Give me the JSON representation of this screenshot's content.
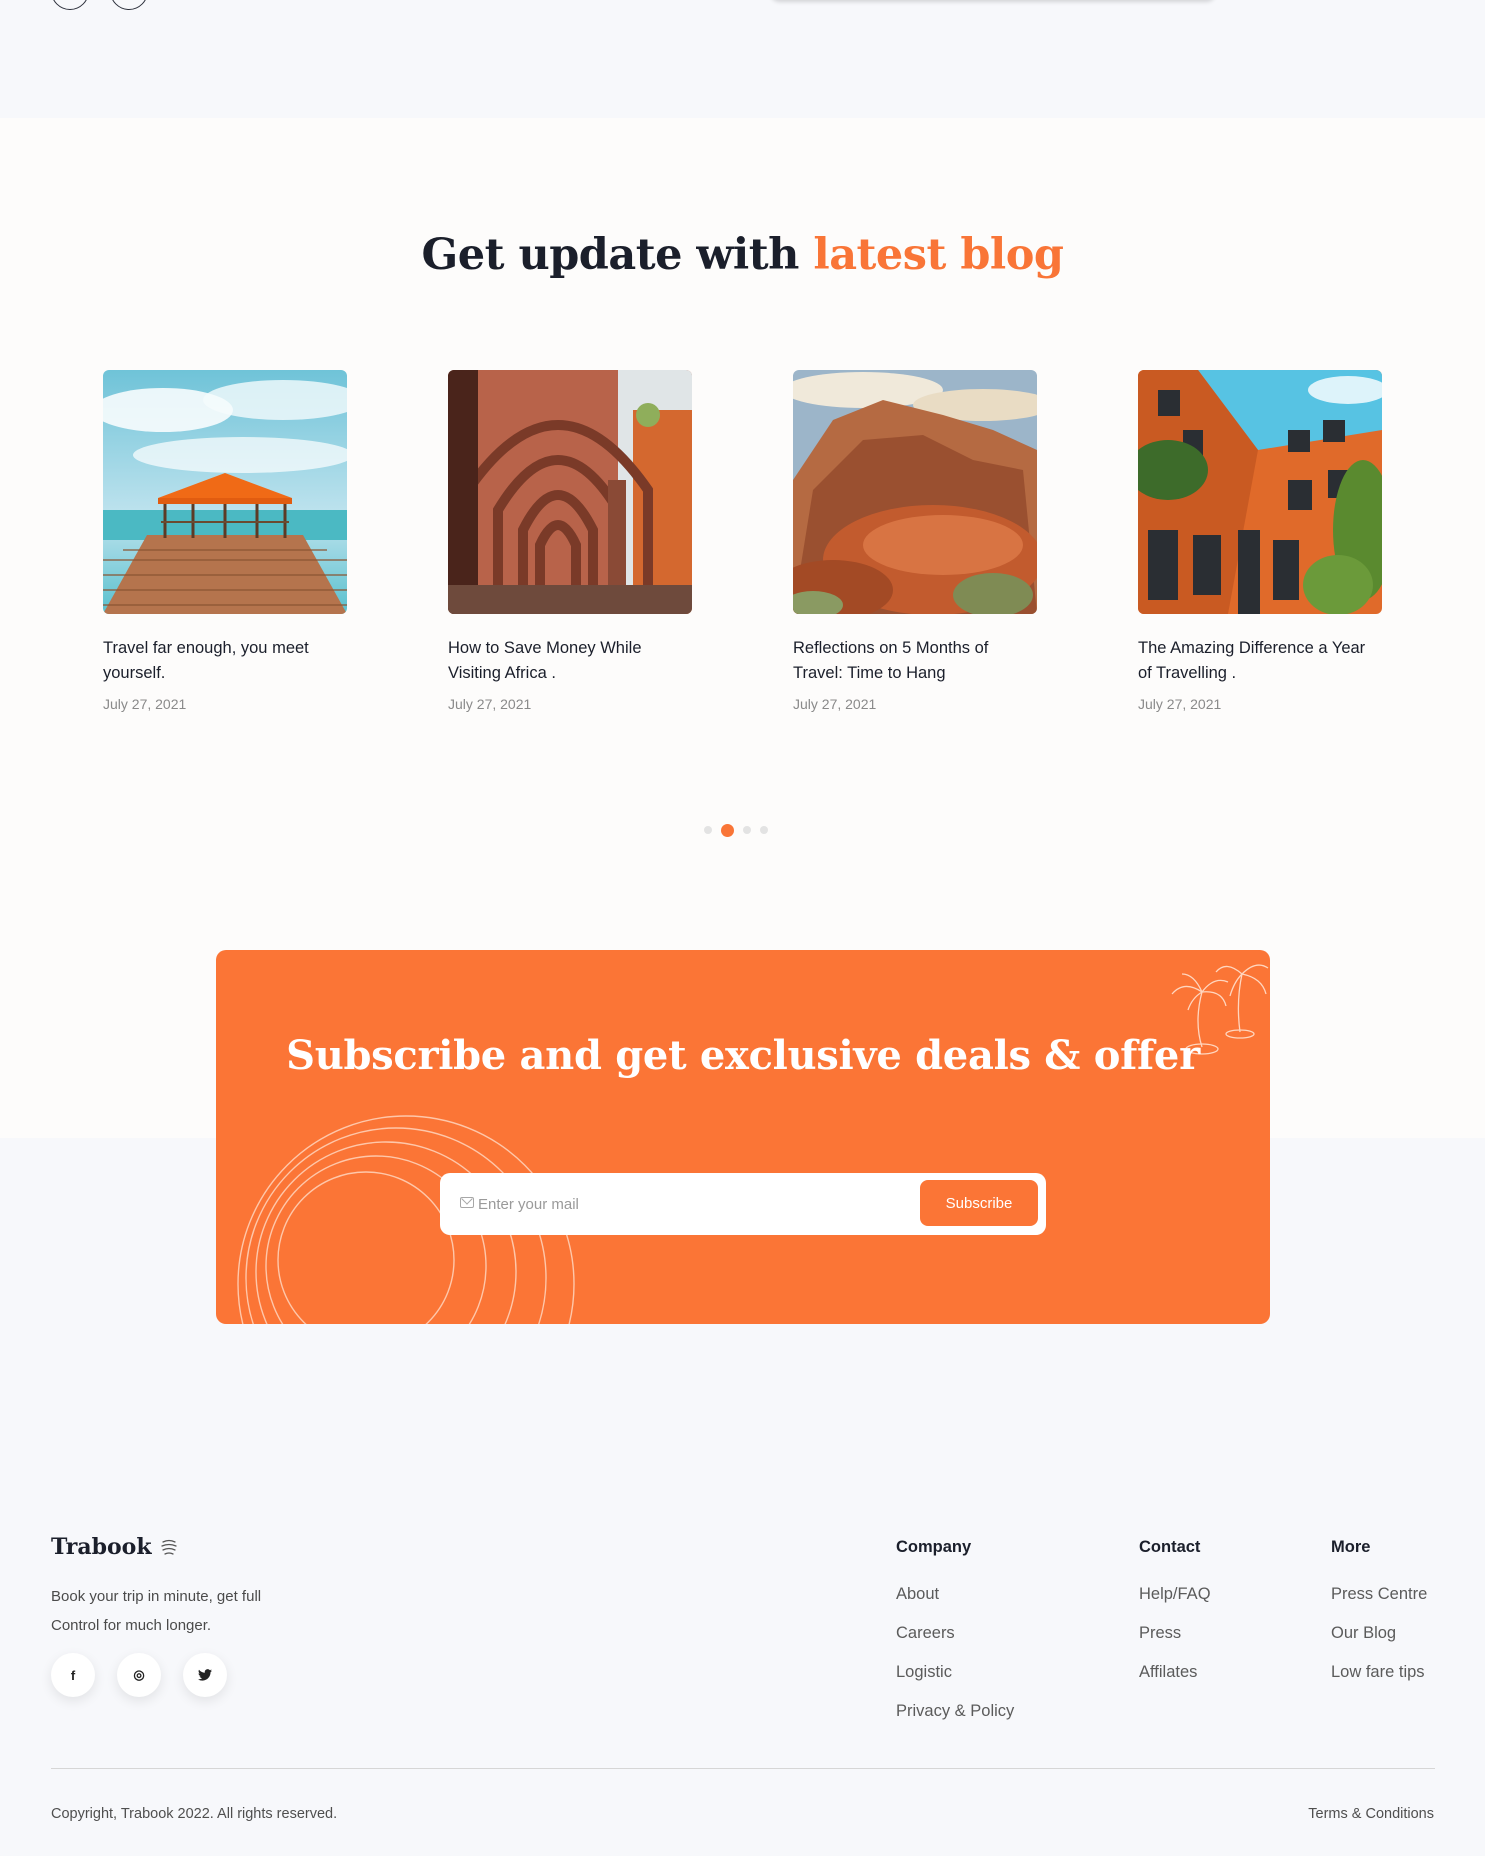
{
  "colors": {
    "accent": "#f97537",
    "dark": "#1b1f2b",
    "muted": "#8a8a8a"
  },
  "blog": {
    "title_dark": "Get update with",
    "title_accent": "latest blog",
    "posts": [
      {
        "title": "Travel far enough, you meet yourself.",
        "date": "July 27, 2021",
        "image": "wooden-pier-gazebo"
      },
      {
        "title": "How to Save Money While Visiting Africa .",
        "date": "July 27, 2021",
        "image": "arcade-corridor"
      },
      {
        "title": "Reflections on 5 Months of Travel: Time to Hang",
        "date": "July 27, 2021",
        "image": "red-rock-canyon"
      },
      {
        "title": "The Amazing Difference a Year of Travelling .",
        "date": "July 27, 2021",
        "image": "orange-building"
      }
    ],
    "carousel": {
      "pages": 4,
      "active": 2
    }
  },
  "subscribe": {
    "title": "Subscribe and get exclusive deals & offer",
    "input_placeholder": "Enter your mail",
    "button_label": "Subscribe",
    "icon": "mail-icon"
  },
  "footer": {
    "brand": "Trabook",
    "tagline": "Book your trip in minute, get full Control for much longer.",
    "socials": [
      {
        "icon": "facebook-icon",
        "glyph": "f"
      },
      {
        "icon": "instagram-icon",
        "glyph": "◎"
      },
      {
        "icon": "twitter-icon",
        "glyph": "🐦"
      }
    ],
    "columns": [
      {
        "heading": "Company",
        "links": [
          "About",
          "Careers",
          "Logistic",
          "Privacy & Policy"
        ]
      },
      {
        "heading": "Contact",
        "links": [
          "Help/FAQ",
          "Press",
          "Affilates"
        ]
      },
      {
        "heading": "More",
        "links": [
          "Press Centre",
          "Our Blog",
          "Low fare tips"
        ]
      }
    ],
    "copyright": "Copyright, Trabook 2022. All rights reserved.",
    "terms": "Terms & Conditions"
  }
}
